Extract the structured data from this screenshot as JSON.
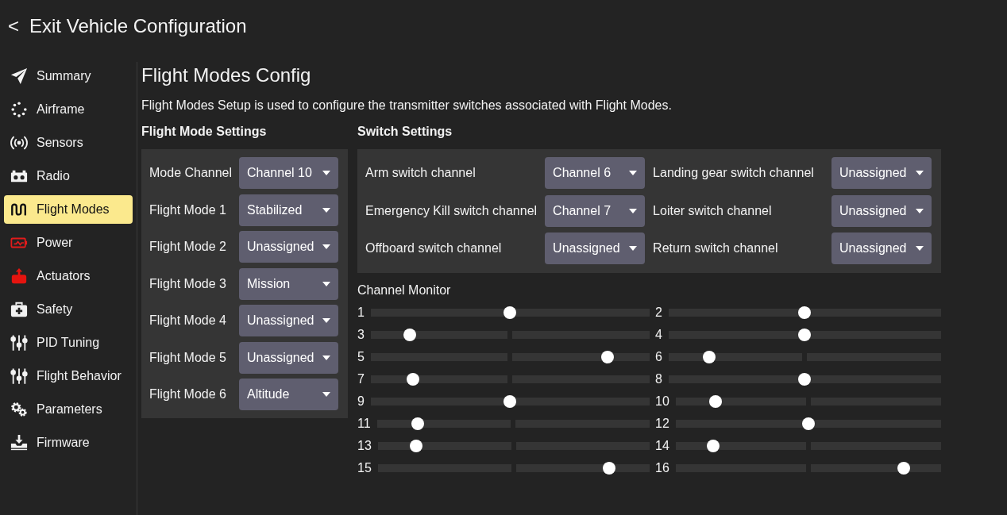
{
  "header": {
    "back_glyph": "<",
    "title": "Exit Vehicle Configuration"
  },
  "sidebar": {
    "items": [
      {
        "label": "Summary",
        "selected": false
      },
      {
        "label": "Airframe",
        "selected": false
      },
      {
        "label": "Sensors",
        "selected": false
      },
      {
        "label": "Radio",
        "selected": false
      },
      {
        "label": "Flight Modes",
        "selected": true
      },
      {
        "label": "Power",
        "selected": false
      },
      {
        "label": "Actuators",
        "selected": false
      },
      {
        "label": "Safety",
        "selected": false
      },
      {
        "label": "PID Tuning",
        "selected": false
      },
      {
        "label": "Flight Behavior",
        "selected": false
      },
      {
        "label": "Parameters",
        "selected": false
      },
      {
        "label": "Firmware",
        "selected": false
      }
    ]
  },
  "page": {
    "title": "Flight Modes Config",
    "description": "Flight Modes Setup is used to configure the transmitter switches associated with Flight Modes."
  },
  "flight_mode_settings": {
    "heading": "Flight Mode Settings",
    "rows": [
      {
        "label": "Mode Channel",
        "value": "Channel 10"
      },
      {
        "label": "Flight Mode 1",
        "value": "Stabilized"
      },
      {
        "label": "Flight Mode 2",
        "value": "Unassigned"
      },
      {
        "label": "Flight Mode 3",
        "value": "Mission"
      },
      {
        "label": "Flight Mode 4",
        "value": "Unassigned"
      },
      {
        "label": "Flight Mode 5",
        "value": "Unassigned"
      },
      {
        "label": "Flight Mode 6",
        "value": "Altitude"
      }
    ]
  },
  "switch_settings": {
    "heading": "Switch Settings",
    "rows": [
      {
        "label": "Arm switch channel",
        "value": "Channel 6"
      },
      {
        "label": "Landing gear switch channel",
        "value": "Unassigned"
      },
      {
        "label": "Emergency Kill switch channel",
        "value": "Channel 7"
      },
      {
        "label": "Loiter switch channel",
        "value": "Unassigned"
      },
      {
        "label": "Offboard switch channel",
        "value": "Unassigned"
      },
      {
        "label": "Return switch channel",
        "value": "Unassigned"
      }
    ]
  },
  "channel_monitor": {
    "title": "Channel Monitor",
    "channels": [
      {
        "number": "1",
        "level": 0.5
      },
      {
        "number": "2",
        "level": 0.5
      },
      {
        "number": "3",
        "level": 0.14
      },
      {
        "number": "4",
        "level": 0.5
      },
      {
        "number": "5",
        "level": 0.85
      },
      {
        "number": "6",
        "level": 0.15
      },
      {
        "number": "7",
        "level": 0.15
      },
      {
        "number": "8",
        "level": 0.5
      },
      {
        "number": "9",
        "level": 0.5
      },
      {
        "number": "10",
        "level": 0.15
      },
      {
        "number": "11",
        "level": 0.15
      },
      {
        "number": "12",
        "level": 0.5
      },
      {
        "number": "13",
        "level": 0.14
      },
      {
        "number": "14",
        "level": 0.14
      },
      {
        "number": "15",
        "level": 0.85
      },
      {
        "number": "16",
        "level": 0.86
      }
    ]
  }
}
